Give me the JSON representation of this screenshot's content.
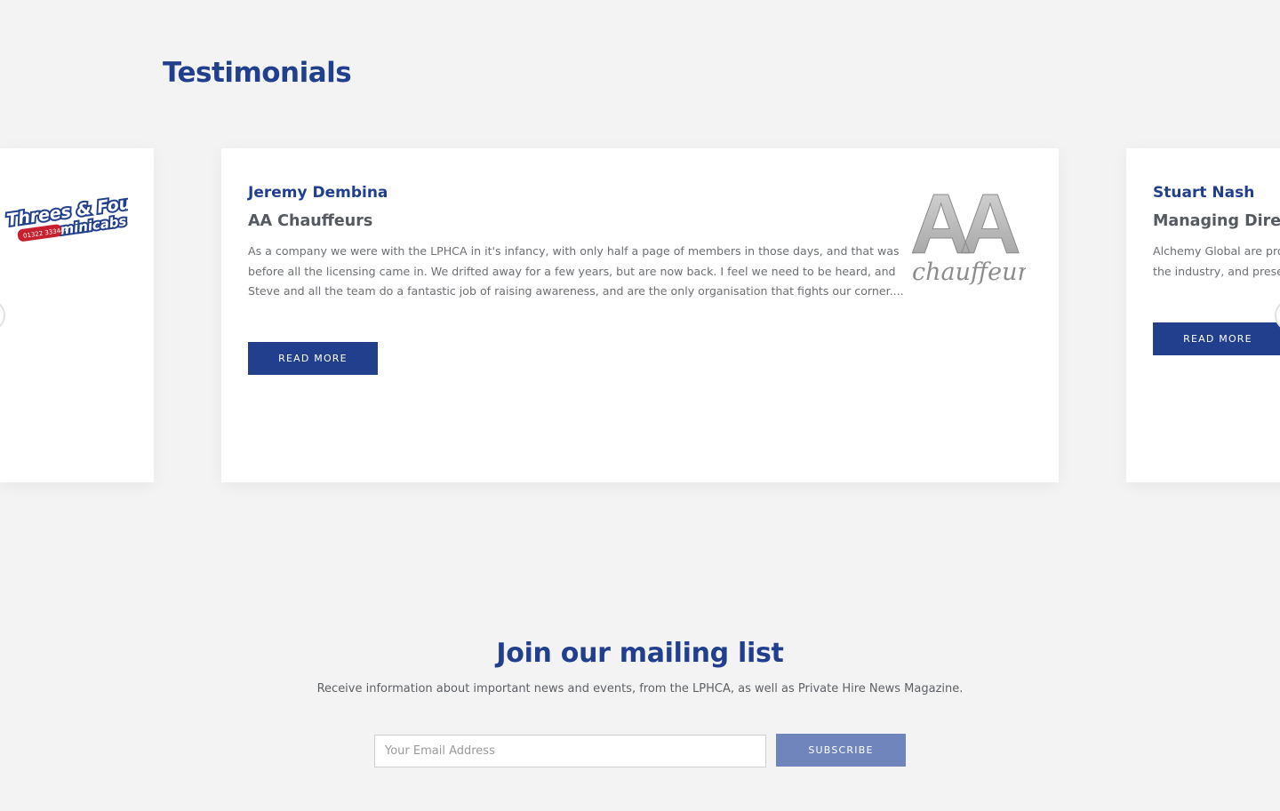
{
  "testimonials": {
    "title": "Testimonials",
    "cards": [
      {
        "logo": "threes-and-fours-minicabs-logo",
        "logo_text": [
          "Threes & Fours",
          "minicabs",
          "01322 333444"
        ]
      },
      {
        "name": "Jeremy Dembina",
        "company": "AA Chauffeurs",
        "quote": "As a company we were with the LPHCA in it's infancy, with only half a page of members in those days, and that was before all the licensing came in. We drifted away for a few years, but are now back. I feel we need to be heard, and Steve and all the team do a fantastic job of raising awareness, and are the only organisation that fights our corner....",
        "read_more": "READ MORE",
        "logo": "aa-chauffeurs-logo",
        "logo_text": [
          "AA",
          "chauffeurs"
        ]
      },
      {
        "name": "Stuart Nash",
        "company": "Managing Direc",
        "quote_lines": [
          "Alchemy Global are pro",
          "the industry, and preser"
        ],
        "read_more": "READ MORE"
      }
    ],
    "prev_icon": "chevron-left-icon",
    "next_icon": "chevron-right-icon"
  },
  "mailing_list": {
    "title": "Join our mailing list",
    "subtitle": "Receive information about important news and events, from the LPHCA, as well as Private Hire News Magazine.",
    "email_placeholder": "Your Email Address",
    "email_value": "",
    "subscribe_label": "SUBSCRIBE"
  },
  "colors": {
    "brand_blue": "#213f8d",
    "subscribe_blue": "#7085bb",
    "background": "#f3f3f3"
  }
}
